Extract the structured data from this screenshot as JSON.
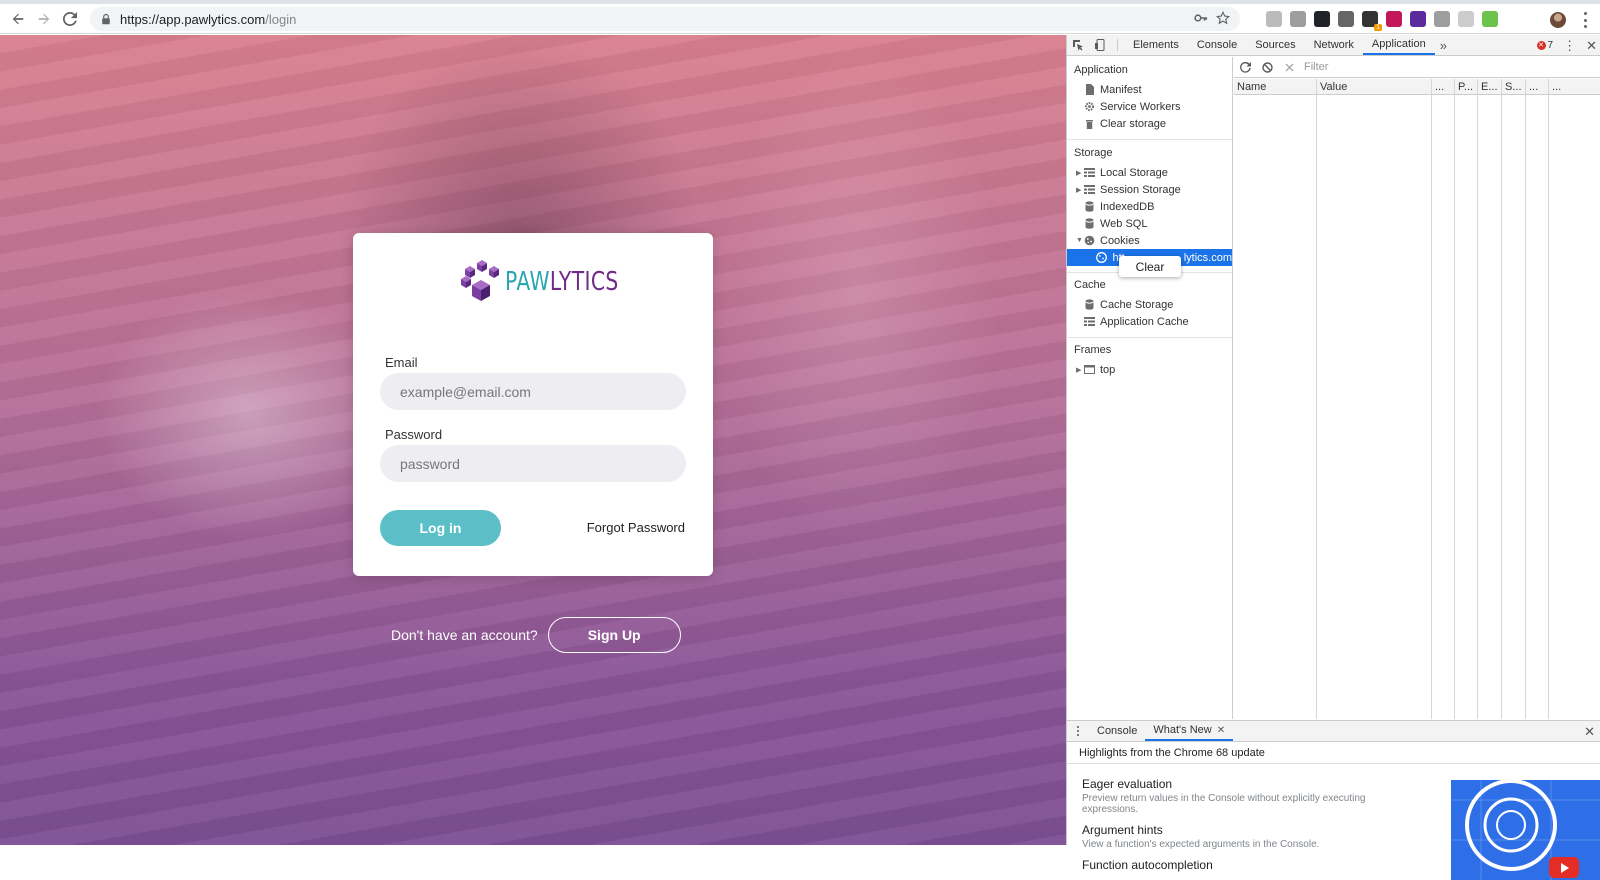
{
  "browser": {
    "url_host": "https://app.pawlytics.com",
    "url_path": "/login",
    "extensions": [
      {
        "icon": "puzzle-ext-icon",
        "color": "#bbbbbb"
      },
      {
        "icon": "screen-ext-icon",
        "color": "#9e9e9e"
      },
      {
        "icon": "react-ext-icon",
        "color": "#20232a"
      },
      {
        "icon": "vue-ext-icon",
        "color": "#666666"
      },
      {
        "icon": "apollo-ext-icon",
        "color": "#333333",
        "badge": "1"
      },
      {
        "icon": "graphql-ext-icon",
        "color": "#c2185b"
      },
      {
        "icon": "w-ext-icon",
        "color": "#5b2b9e"
      },
      {
        "icon": "a-ext-icon",
        "color": "#9e9e9e"
      },
      {
        "icon": "circle-ext-icon",
        "color": "#cccccc"
      },
      {
        "icon": "node-ext-icon",
        "color": "#6cc24a"
      }
    ]
  },
  "login": {
    "logo_paw": "PAW",
    "logo_lytics": "LYTICS",
    "email_label": "Email",
    "email_placeholder": "example@email.com",
    "password_label": "Password",
    "password_placeholder": "password",
    "login_button": "Log in",
    "forgot_link": "Forgot Password",
    "signup_prompt": "Don't have an account?",
    "signup_button": "Sign Up"
  },
  "devtools": {
    "tabs": [
      "Elements",
      "Console",
      "Sources",
      "Network",
      "Application"
    ],
    "active_tab": "Application",
    "more": "»",
    "error_count": "7",
    "sidebar": {
      "application_title": "Application",
      "manifest": "Manifest",
      "service_workers": "Service Workers",
      "clear_storage": "Clear storage",
      "storage_title": "Storage",
      "local_storage": "Local Storage",
      "session_storage": "Session Storage",
      "indexeddb": "IndexedDB",
      "web_sql": "Web SQL",
      "cookies": "Cookies",
      "cookie_host_prefix": "htt",
      "cookie_host_suffix": "lytics.com",
      "cache_title": "Cache",
      "cache_storage": "Cache Storage",
      "application_cache": "Application Cache",
      "frames_title": "Frames",
      "frame_top": "top"
    },
    "context_menu": "Clear",
    "filter_placeholder": "Filter",
    "columns": [
      "Name",
      "Value",
      "...",
      "P...",
      "E...",
      "S...",
      "...",
      "..."
    ],
    "drawer": {
      "tabs": [
        "Console",
        "What's New"
      ],
      "heading": "Highlights from the Chrome 68 update",
      "items": [
        {
          "title": "Eager evaluation",
          "desc": "Preview return values in the Console without explicitly executing expressions."
        },
        {
          "title": "Argument hints",
          "desc": "View a function's expected arguments in the Console."
        },
        {
          "title": "Function autocompletion",
          "desc": ""
        }
      ]
    }
  }
}
